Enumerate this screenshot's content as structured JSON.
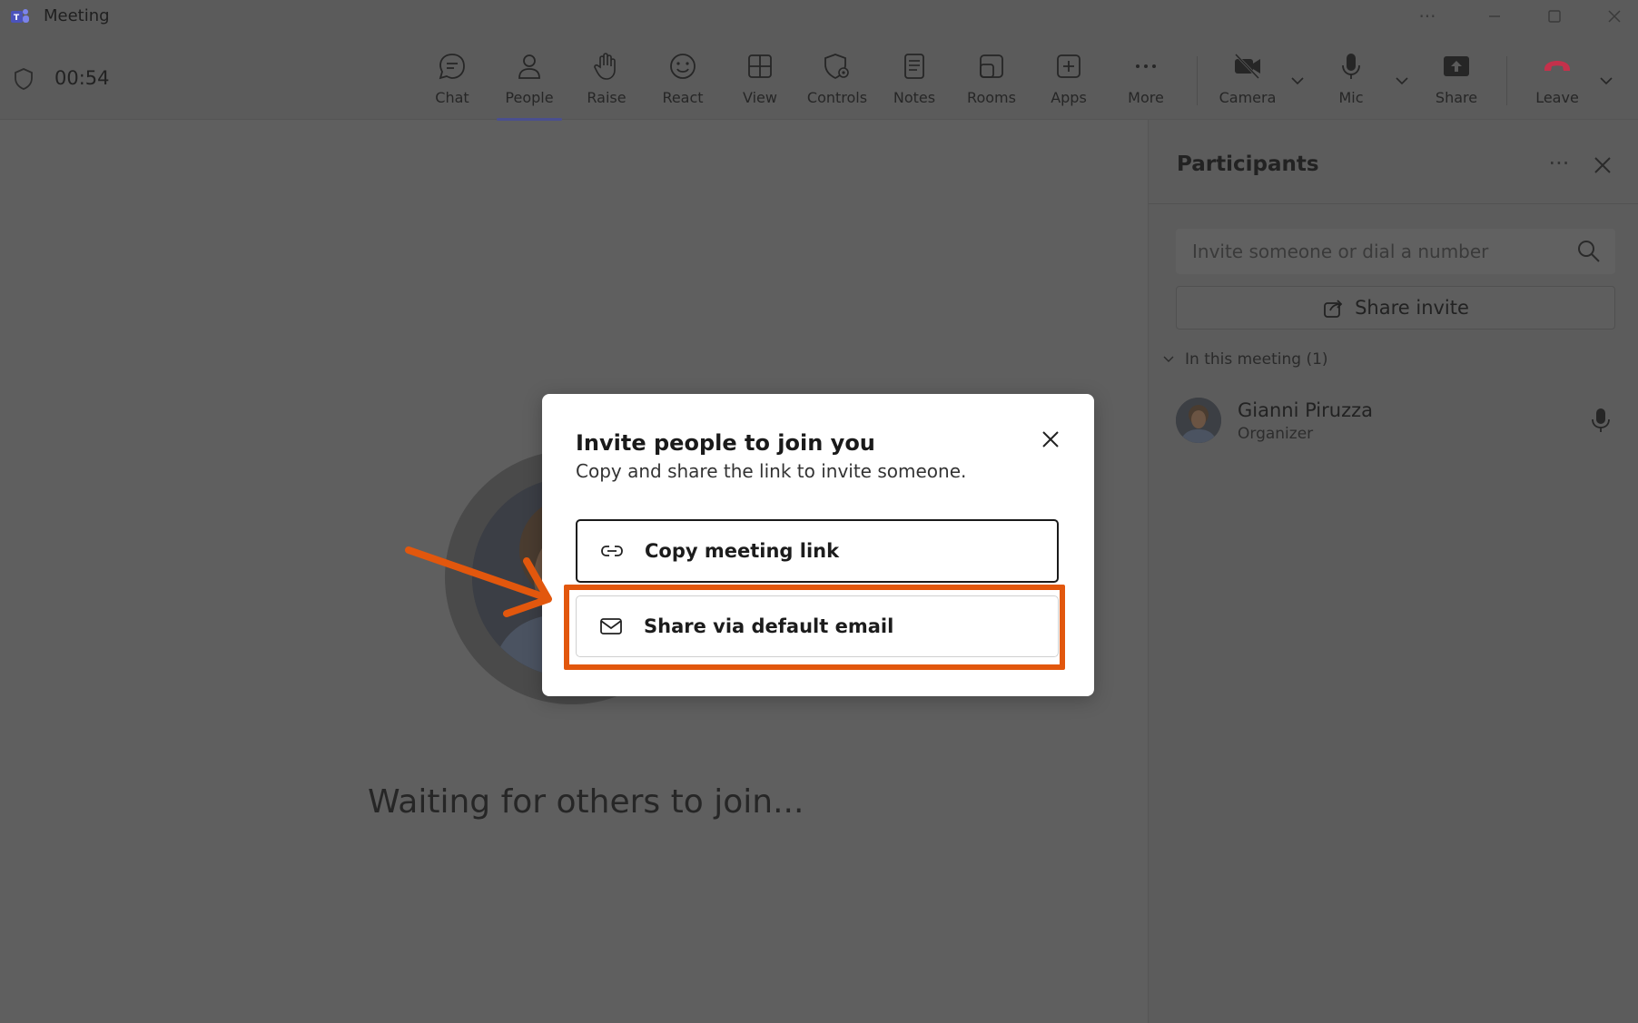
{
  "window": {
    "title": "Meeting",
    "controls": [
      "more",
      "minimize",
      "maximize",
      "close"
    ]
  },
  "toolbar": {
    "timer": "00:54",
    "buttons": [
      {
        "id": "chat",
        "label": "Chat",
        "icon": "chat-icon"
      },
      {
        "id": "people",
        "label": "People",
        "icon": "people-icon",
        "active": true
      },
      {
        "id": "raise",
        "label": "Raise",
        "icon": "hand-icon"
      },
      {
        "id": "react",
        "label": "React",
        "icon": "smile-icon"
      },
      {
        "id": "view",
        "label": "View",
        "icon": "grid-icon"
      },
      {
        "id": "controls",
        "label": "Controls",
        "icon": "shield-gear-icon"
      },
      {
        "id": "notes",
        "label": "Notes",
        "icon": "notes-icon"
      },
      {
        "id": "rooms",
        "label": "Rooms",
        "icon": "rooms-icon"
      },
      {
        "id": "apps",
        "label": "Apps",
        "icon": "plus-icon"
      },
      {
        "id": "more",
        "label": "More",
        "icon": "ellipsis-icon"
      },
      {
        "id": "camera",
        "label": "Camera",
        "icon": "camera-off-icon"
      },
      {
        "id": "mic",
        "label": "Mic",
        "icon": "mic-icon"
      },
      {
        "id": "share",
        "label": "Share",
        "icon": "share-tray-icon"
      },
      {
        "id": "leave",
        "label": "Leave",
        "icon": "phone-hangup-icon"
      }
    ]
  },
  "stage": {
    "waiting_text": "Waiting for others to join..."
  },
  "participants": {
    "title": "Participants",
    "search_placeholder": "Invite someone or dial a number",
    "share_invite_label": "Share invite",
    "section_label": "In this meeting (1)",
    "people": [
      {
        "name": "Gianni Piruzza",
        "role": "Organizer"
      }
    ]
  },
  "dialog": {
    "title": "Invite people to join you",
    "subtitle": "Copy and share the link to invite someone.",
    "copy_link_label": "Copy meeting link",
    "email_label": "Share via default email"
  },
  "colors": {
    "accent": "#4a4f8f",
    "annotation": "#e2570d",
    "leave": "#c4314b"
  }
}
